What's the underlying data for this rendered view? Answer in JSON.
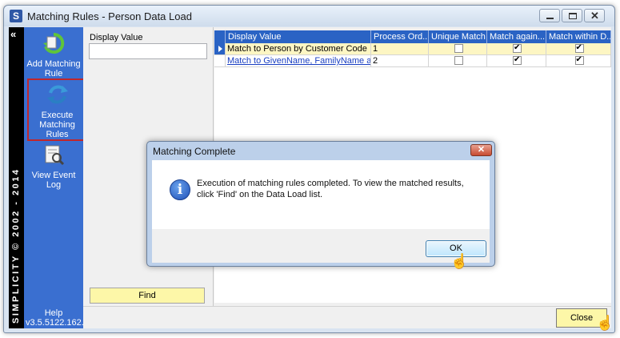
{
  "window": {
    "app_icon_letter": "S",
    "title": "Matching Rules - Person Data Load",
    "min_glyph": "",
    "close_glyph": "✕"
  },
  "nav": {
    "collapse_glyph": "«",
    "brand": "SIMPLICITY © 2002 - 2014",
    "items": [
      {
        "label": "Add Matching Rule"
      },
      {
        "label": "Execute Matching Rules"
      },
      {
        "label": "View Event Log"
      }
    ],
    "help_label": "Help",
    "version": "v3.5.5122.162..."
  },
  "filter": {
    "label": "Display Value",
    "value": "",
    "find_label": "Find"
  },
  "grid": {
    "columns": [
      "Display Value",
      "Process Ord...",
      "Unique Match",
      "Match again...",
      "Match within D..."
    ],
    "rows": [
      {
        "display_value": "Match to Person by Customer Code",
        "process_order": "1",
        "unique_match": false,
        "match_against": true,
        "match_within": true
      },
      {
        "display_value": "Match to GivenName, FamilyName a...",
        "process_order": "2",
        "unique_match": false,
        "match_against": true,
        "match_within": true
      }
    ]
  },
  "footer": {
    "close_label": "Close"
  },
  "dialog": {
    "title": "Matching Complete",
    "close_glyph": "✕",
    "icon_glyph": "i",
    "message_line1": "Execution of matching rules completed. To view the matched results,",
    "message_line2": "click 'Find' on the Data Load list.",
    "ok_label": "OK"
  },
  "colors": {
    "nav_bg": "#3a6fd0",
    "header_bg": "#2a63c4",
    "selected_row": "#fdf6c3",
    "button_yellow": "#fdf7a8",
    "highlight_border": "#c0262b"
  },
  "cursor_glyph": "☝"
}
